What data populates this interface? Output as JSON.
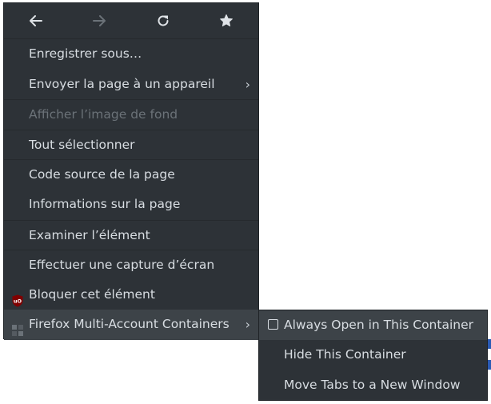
{
  "nav": {
    "back_icon": "arrow-left-icon",
    "forward_icon": "arrow-right-icon",
    "reload_icon": "reload-icon",
    "bookmark_icon": "star-icon"
  },
  "menu": {
    "items": [
      {
        "label": "Enregistrer sous…"
      },
      {
        "label": "Envoyer la page à un appareil",
        "submenu": true
      },
      {
        "label": "Afficher l’image de fond",
        "disabled": true
      },
      {
        "label": "Tout sélectionner"
      },
      {
        "label": "Code source de la page"
      },
      {
        "label": "Informations sur la page"
      },
      {
        "label": "Examiner l’élément"
      },
      {
        "label": "Effectuer une capture d’écran"
      },
      {
        "label": "Bloquer cet élément",
        "icon": "ublock-icon"
      },
      {
        "label": "Firefox Multi-Account Containers",
        "icon": "containers-icon",
        "submenu": true,
        "highlighted": true
      }
    ]
  },
  "submenu": {
    "items": [
      {
        "label": "Always Open in This Container",
        "checkbox": false
      },
      {
        "label": "Hide This Container"
      },
      {
        "label": "Move Tabs to a New Window"
      }
    ]
  },
  "colors": {
    "menu_bg": "#2d3237",
    "highlight_bg": "#3d4348",
    "text": "#d8dde2",
    "disabled_text": "#6b7278",
    "ublock_red": "#800000",
    "link_blue": "#2a5ab4"
  }
}
